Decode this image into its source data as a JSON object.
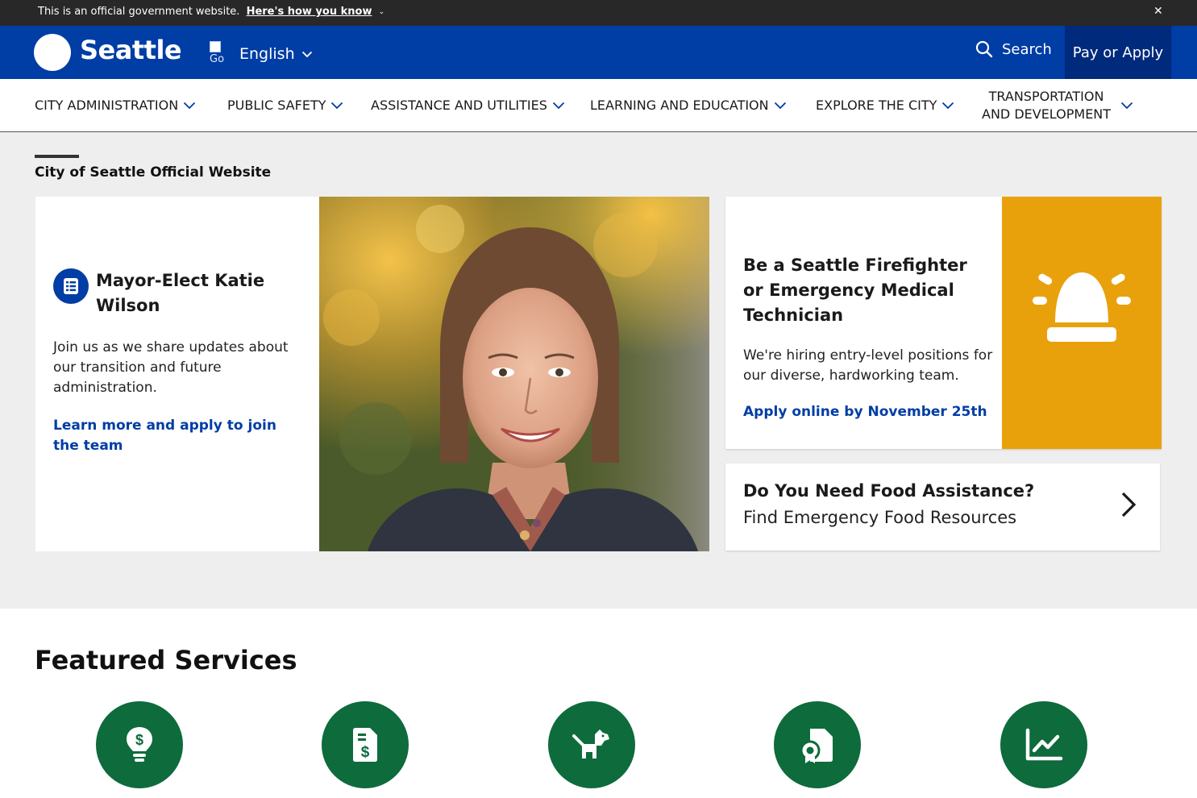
{
  "gov_banner": {
    "text": "This is an official government website.",
    "link": "Here's how you know",
    "chevron": "⌄",
    "close": "✕"
  },
  "header": {
    "logo_text": "Seattle",
    "translate_alt": "Go",
    "language": "English",
    "search_label": "Search",
    "pay_label": "Pay or Apply"
  },
  "nav": {
    "items": [
      {
        "label": "CITY ADMINISTRATION"
      },
      {
        "label": "PUBLIC SAFETY"
      },
      {
        "label": "ASSISTANCE AND UTILITIES"
      },
      {
        "label": "LEARNING AND EDUCATION"
      },
      {
        "label": "EXPLORE THE CITY"
      },
      {
        "label": "TRANSPORTATION\nAND DEVELOPMENT"
      }
    ]
  },
  "hero": {
    "section_title": "City of Seattle Official Website",
    "main_card": {
      "title": "Mayor-Elect Katie Wilson",
      "description": "Join us as we share updates about our transition and future administration.",
      "link": "Learn more and apply to join the team"
    },
    "fire_card": {
      "title": "Be a Seattle Firefighter or Emergency Medical Technician",
      "description": "We're hiring entry-level positions for our diverse, hardworking team.",
      "link": "Apply online by November 25th"
    },
    "food_card": {
      "title": "Do You Need Food Assistance?",
      "subtitle": "Find Emergency Food Resources"
    }
  },
  "featured": {
    "title": "Featured Services",
    "icons": [
      "lightbulb-dollar-icon",
      "bill-document-icon",
      "dog-icon",
      "license-certificate-icon",
      "line-chart-icon"
    ]
  },
  "colors": {
    "header_blue": "#003da5",
    "pay_button": "#002a7c",
    "gov_banner": "#282828",
    "link_blue": "#003da5",
    "alert_orange": "#e9a10b",
    "service_green": "#0d6b3c",
    "hero_bg": "#eeeeee"
  }
}
